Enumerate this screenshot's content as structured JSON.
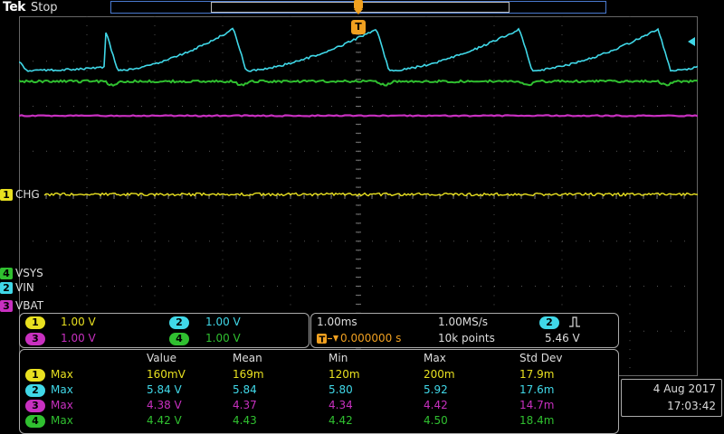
{
  "header": {
    "brand": "Tek",
    "run_state": "Stop"
  },
  "colors": {
    "ch1": "#e8e020",
    "ch2": "#40d8e8",
    "ch3": "#c830c0",
    "ch4": "#30c030",
    "trigger": "#f0a020",
    "grid": "#555"
  },
  "channels": [
    {
      "num": "1",
      "name": "CHG",
      "scale": "1.00 V"
    },
    {
      "num": "2",
      "name": "VIN",
      "scale": "1.00 V"
    },
    {
      "num": "3",
      "name": "VBAT",
      "scale": "1.00 V"
    },
    {
      "num": "4",
      "name": "VSYS",
      "scale": "1.00 V"
    }
  ],
  "trigger_marker": "T",
  "timebase": {
    "horizontal": "1.00ms",
    "sample_rate": "1.00MS/s",
    "trigger_position": "0.000000 s",
    "record_length": "10k points",
    "trigger_source": "2",
    "trigger_level": "5.46 V"
  },
  "measurements": {
    "headers": [
      "Value",
      "Mean",
      "Min",
      "Max",
      "Std Dev"
    ],
    "rows": [
      {
        "ch": "1",
        "type": "Max",
        "value": "160mV",
        "mean": "169m",
        "min": "120m",
        "max": "200m",
        "std": "17.9m"
      },
      {
        "ch": "2",
        "type": "Max",
        "value": "5.84 V",
        "mean": "5.84",
        "min": "5.80",
        "max": "5.92",
        "std": "17.6m"
      },
      {
        "ch": "3",
        "type": "Max",
        "value": "4.38 V",
        "mean": "4.37",
        "min": "4.34",
        "max": "4.42",
        "std": "14.7m"
      },
      {
        "ch": "4",
        "type": "Max",
        "value": "4.42 V",
        "mean": "4.43",
        "min": "4.42",
        "max": "4.50",
        "std": "18.4m"
      }
    ]
  },
  "datetime": {
    "date": "4 Aug 2017",
    "time": "17:03:42"
  }
}
